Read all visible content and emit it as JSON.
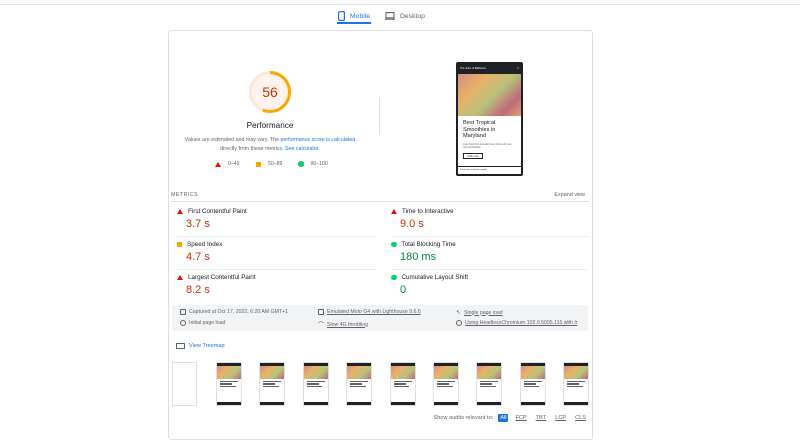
{
  "tabs": [
    {
      "label": "Mobile",
      "icon": "mobile-icon",
      "active": true
    },
    {
      "label": "Desktop",
      "icon": "desktop-icon",
      "active": false
    }
  ],
  "performance": {
    "score": "56",
    "score_fraction": 0.56,
    "title": "Performance",
    "note_prefix": "Values are estimated and may vary. The ",
    "note_link1": "performance score is calculated",
    "note_mid": " directly from these metrics. ",
    "note_link2": "See calculator.",
    "legend": [
      {
        "range": "0–49",
        "shape": "triangle",
        "color": "#eb0f00"
      },
      {
        "range": "50–89",
        "shape": "square",
        "color": "#f2a900"
      },
      {
        "range": "90–100",
        "shape": "circle",
        "color": "#0cce6b"
      }
    ]
  },
  "screenshot": {
    "header": "The Juice of Baltimore",
    "title": "Best Tropical Smoothies in Maryland",
    "text": "Juicy fresh fruit and dairy-free drinks with your own combination",
    "button": "Order now",
    "bar": "Juicy fresh summer sample"
  },
  "metrics": {
    "heading": "METRICS",
    "expand": "Expand view",
    "items": [
      {
        "label": "First Contentful Paint",
        "value": "3.7 s",
        "status": "red"
      },
      {
        "label": "Time to Interactive",
        "value": "9.0 s",
        "status": "red"
      },
      {
        "label": "Speed Index",
        "value": "4.7 s",
        "status": "orange"
      },
      {
        "label": "Total Blocking Time",
        "value": "180 ms",
        "status": "green"
      },
      {
        "label": "Largest Contentful Paint",
        "value": "8.2 s",
        "status": "red"
      },
      {
        "label": "Cumulative Layout Shift",
        "value": "0",
        "status": "green"
      }
    ]
  },
  "runtime": {
    "captured": "Captured at Oct 17, 2022, 6:20 AM GMT+1",
    "initial_load": "Initial page load",
    "device": "Emulated Moto G4 with Lighthouse 9.6.6",
    "throttling": "Slow 4G throttling",
    "single_load": "Single page load",
    "browser": "Using HeadlessChromium 102.0.5005.115 with lr"
  },
  "treemap": {
    "label": "View Treemap"
  },
  "filmstrip_count": 9,
  "audits": {
    "label": "Show audits relevant to:",
    "filters": [
      "All",
      "FCP",
      "TBT",
      "LCP",
      "CLS"
    ],
    "active": "All"
  }
}
